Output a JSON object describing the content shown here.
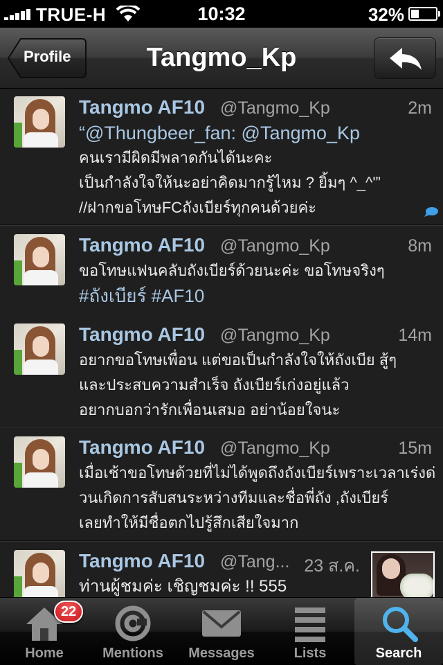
{
  "status_bar": {
    "carrier": "TRUE-H",
    "time": "10:32",
    "battery": "32%",
    "battery_level": 0.32
  },
  "nav": {
    "back_label": "Profile",
    "title": "Tangmo_Kp",
    "reply_icon": "reply-arrow-icon"
  },
  "tweets": [
    {
      "name": "Tangmo AF10",
      "handle": "@Tangmo_Kp",
      "time": "2m",
      "lines": [
        "“@Thungbeer_fan: @Tangmo_Kp",
        "คนเรามีผิดมีพลาดกันได้นะคะ",
        "เป็นกำลังใจให้นะอย่าคิดมากรู้ไหม ? ยิ้มๆ ^_^'”",
        "//ฝากขอโทษFCถังเบียร์ทุกคนด้วยค่ะ"
      ],
      "has_conversation": true
    },
    {
      "name": "Tangmo AF10",
      "handle": "@Tangmo_Kp",
      "time": "8m",
      "lines": [
        "ขอโทษแฟนคลับถังเบียร์ด้วยนะค่ะ ขอโทษจริงๆ",
        "#ถังเบียร์ #AF10"
      ]
    },
    {
      "name": "Tangmo AF10",
      "handle": "@Tangmo_Kp",
      "time": "14m",
      "lines": [
        "อยากขอโทษเพื่อน แต่ขอเป็นกำลังใจให้ถังเบีย สู้ๆ",
        "และประสบความสำเร็จ ถังเบียร์เก่งอยู่แล้ว",
        "อยากบอกว่ารักเพื่อนเสมอ อย่าน้อยใจนะ"
      ]
    },
    {
      "name": "Tangmo AF10",
      "handle": "@Tangmo_Kp",
      "time": "15m",
      "lines": [
        "เมื่อเช้าขอโทษด้วยที่ไม่ได้พูดถึงถังเบียร์เพราะเวลาเร่งด่",
        "วนเกิดการสับสนระหว่างทีมและชื่อพี่ถัง ,ถังเบียร์",
        "เลยทำให้มีชื่อตกไปรู้สึกเสียใจมาก"
      ]
    },
    {
      "name": "Tangmo AF10",
      "handle": "@Tang...",
      "time": "23 ส.ค.",
      "lines": [
        "ท่านผู้ชมค่ะ เชิญชมค่ะ !! 555"
      ],
      "has_photo": true
    }
  ],
  "tabs": [
    {
      "label": "Home",
      "icon": "home-icon",
      "badge": "22"
    },
    {
      "label": "Mentions",
      "icon": "at-sign-icon"
    },
    {
      "label": "Messages",
      "icon": "envelope-icon"
    },
    {
      "label": "Lists",
      "icon": "list-icon"
    },
    {
      "label": "Search",
      "icon": "magnifier-icon",
      "active": true
    }
  ]
}
